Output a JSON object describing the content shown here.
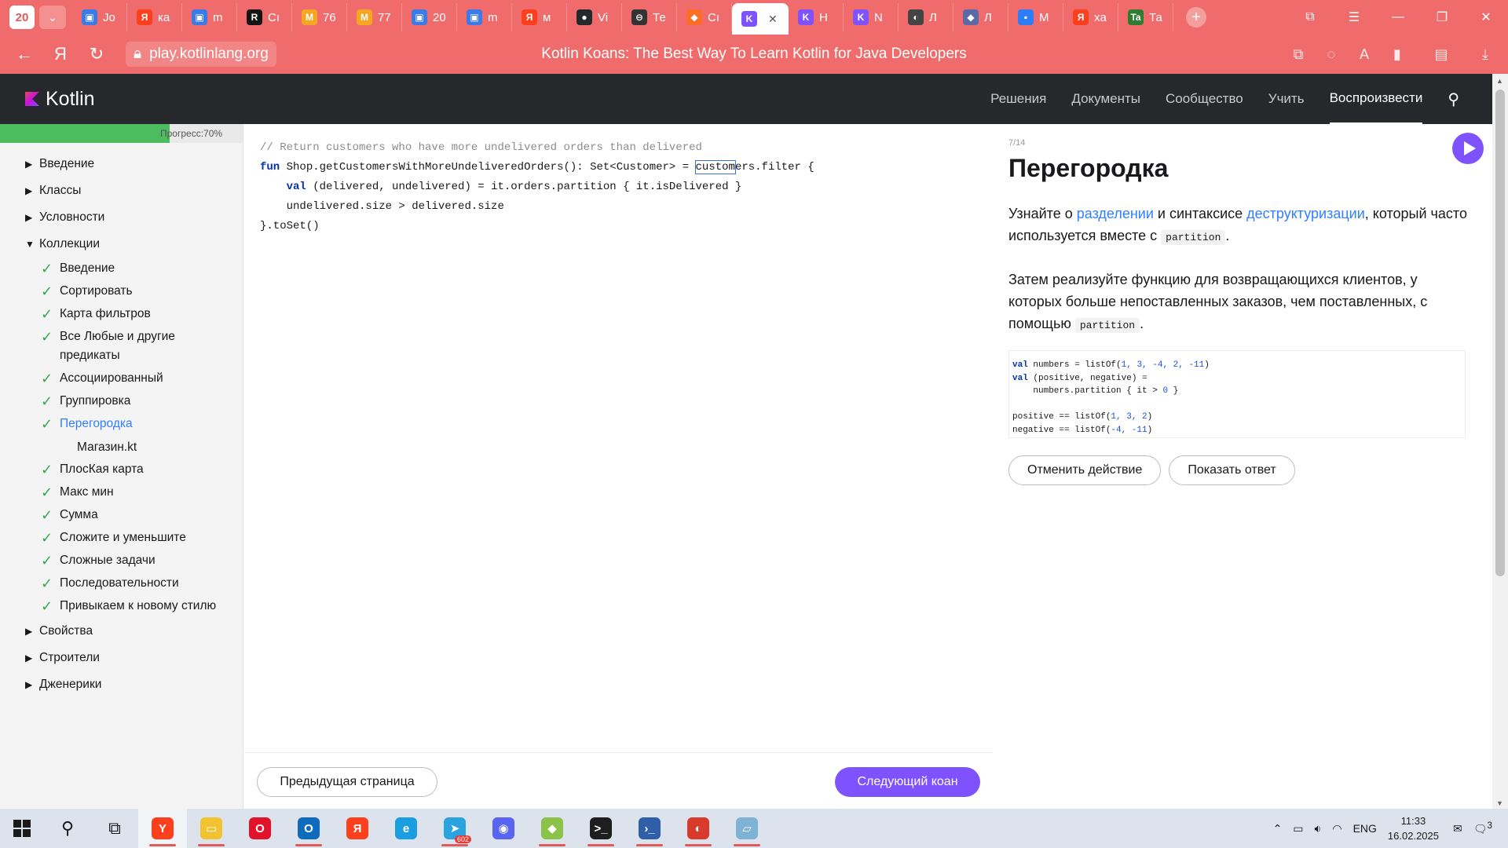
{
  "browser": {
    "tab_count": "20",
    "tabs": [
      {
        "label": "Jo",
        "color": "#3b7be8",
        "glyph": "▣"
      },
      {
        "label": "ка",
        "color": "#fc3f1d",
        "glyph": "Я"
      },
      {
        "label": "m",
        "color": "#3b7be8",
        "glyph": "▣"
      },
      {
        "label": "Cı",
        "color": "#141414",
        "glyph": "R"
      },
      {
        "label": "76",
        "color": "#f5a623",
        "glyph": "M"
      },
      {
        "label": "77",
        "color": "#f5a623",
        "glyph": "M"
      },
      {
        "label": "20",
        "color": "#3b7be8",
        "glyph": "▣"
      },
      {
        "label": "m",
        "color": "#3b7be8",
        "glyph": "▣"
      },
      {
        "label": "м",
        "color": "#fc3f1d",
        "glyph": "Я"
      },
      {
        "label": "Vi",
        "color": "#24292e",
        "glyph": "●"
      },
      {
        "label": "Те",
        "color": "#333333",
        "glyph": "⊖"
      },
      {
        "label": "Сı",
        "color": "#fc6d26",
        "glyph": "◆"
      },
      {
        "label": "",
        "color": "#7f52ff",
        "glyph": "K",
        "active": true
      },
      {
        "label": "H",
        "color": "#7f52ff",
        "glyph": "K"
      },
      {
        "label": "N",
        "color": "#7f52ff",
        "glyph": "K"
      },
      {
        "label": "Л",
        "color": "#444444",
        "glyph": "◐"
      },
      {
        "label": "Л",
        "color": "#5b6aa6",
        "glyph": "◆"
      },
      {
        "label": "M",
        "color": "#2d7df6",
        "glyph": "▪"
      },
      {
        "label": "xa",
        "color": "#fc3f1d",
        "glyph": "Я"
      },
      {
        "label": "Та",
        "color": "#2e7d32",
        "glyph": "Ta"
      }
    ],
    "url": "play.kotlinlang.org",
    "page_title": "Kotlin Koans: The Best Way To Learn Kotlin for Java Developers"
  },
  "site": {
    "logo": "Kotlin",
    "nav": [
      "Решения",
      "Документы",
      "Сообщество",
      "Учить",
      "Воспроизвести"
    ],
    "active_nav": "Воспроизвести"
  },
  "sidebar": {
    "progress": 0.7,
    "progress_label": "Прогресс:70%",
    "sections_before": [
      "Введение",
      "Классы",
      "Условности"
    ],
    "open_section": "Коллекции",
    "items": [
      {
        "label": "Введение",
        "done": true
      },
      {
        "label": "Сортировать",
        "done": true
      },
      {
        "label": "Карта фильтров",
        "done": true
      },
      {
        "label": "Все Любые и другие предикаты",
        "done": true
      },
      {
        "label": "Ассоциированный",
        "done": true
      },
      {
        "label": "Группировка",
        "done": true
      },
      {
        "label": "Перегородка",
        "done": true,
        "active": true
      }
    ],
    "file": "Магазин.kt",
    "items_after": [
      {
        "label": "ПлосКая карта",
        "done": true
      },
      {
        "label": "Макс мин",
        "done": true
      },
      {
        "label": "Сумма",
        "done": true
      },
      {
        "label": "Сложите и уменьшите",
        "done": true
      },
      {
        "label": "Сложные задачи",
        "done": true
      },
      {
        "label": "Последовательности",
        "done": true
      },
      {
        "label": "Привыкаем к новому стилю",
        "done": true
      }
    ],
    "sections_after": [
      "Свойства",
      "Строители",
      "Дженерики"
    ]
  },
  "editor": {
    "comment": "// Return customers who have more undelivered orders than delivered",
    "line1_kw": "fun",
    "line1_a": " Shop.getCustomersWithMoreUndeliveredOrders(): Set<Customer> = ",
    "line1_sel": "custom",
    "line1_b": "ers.filter {",
    "line2_kw": "val",
    "line2": " (delivered, undelivered) = it.orders.partition { it.isDelivered }",
    "line3": "undelivered.size > delivered.size",
    "line4": "}.toSet()",
    "prev_label": "Предыдущая страница",
    "next_label": "Следующий коан"
  },
  "panel": {
    "counter": "7/14",
    "title": "Перегородка",
    "p1_a": "Узнайте о ",
    "p1_link1": "разделении",
    "p1_b": " и синтаксисе ",
    "p1_link2": "деструктуризации",
    "p1_c": ", который часто используется вместе с ",
    "p1_code": "partition",
    "p1_d": ".",
    "p2_a": "Затем реализуйте функцию для возвращающихся клиентов, у которых больше непоставленных заказов, чем поставленных, с помощью ",
    "p2_code": "partition",
    "p2_b": ".",
    "sample": {
      "l1_kw": "val",
      "l1_a": " numbers = listOf(",
      "l1_n": "1, 3, -4, 2, -11",
      "l1_b": ")",
      "l2_kw": "val",
      "l2": " (positive, negative) =",
      "l3_a": "    numbers.partition { it > ",
      "l3_n": "0",
      "l3_b": " }",
      "l5_a": "positive == listOf(",
      "l5_n": "1, 3, 2",
      "l5_b": ")",
      "l6_a": "negative == listOf(",
      "l6_n": "-4, -11",
      "l6_b": ")"
    },
    "undo_label": "Отменить действие",
    "answer_label": "Показать ответ"
  },
  "taskbar": {
    "apps": [
      {
        "name": "yandex-browser",
        "glyph": "Y",
        "color": "#fc3f1d",
        "run": true,
        "focus": true
      },
      {
        "name": "file-explorer",
        "glyph": "▭",
        "color": "#f2c230",
        "run": true
      },
      {
        "name": "opera",
        "glyph": "O",
        "color": "#e3122b",
        "run": false
      },
      {
        "name": "outlook",
        "glyph": "O",
        "color": "#0f6cbd",
        "run": true
      },
      {
        "name": "yandex",
        "glyph": "Я",
        "color": "#fc3f1d",
        "run": false
      },
      {
        "name": "edge",
        "glyph": "e",
        "color": "#1b9de2",
        "run": false
      },
      {
        "name": "telegram",
        "glyph": "➤",
        "color": "#2aa3df",
        "run": true
      },
      {
        "name": "discord",
        "glyph": "◉",
        "color": "#5865f2",
        "run": false
      },
      {
        "name": "tool",
        "glyph": "◆",
        "color": "#8bc34a",
        "run": true
      },
      {
        "name": "terminal",
        "glyph": ">_",
        "color": "#1e1e1e",
        "run": true
      },
      {
        "name": "powershell",
        "glyph": "›_",
        "color": "#2f5fa8",
        "run": true
      },
      {
        "name": "app-red",
        "glyph": "◐",
        "color": "#d83b2b",
        "run": true
      },
      {
        "name": "notes",
        "glyph": "▱",
        "color": "#7fb3d5",
        "run": true
      }
    ],
    "telegram_badge": "602",
    "lang": "ENG",
    "time": "11:33",
    "date": "16.02.2025",
    "notif_count": "3"
  }
}
